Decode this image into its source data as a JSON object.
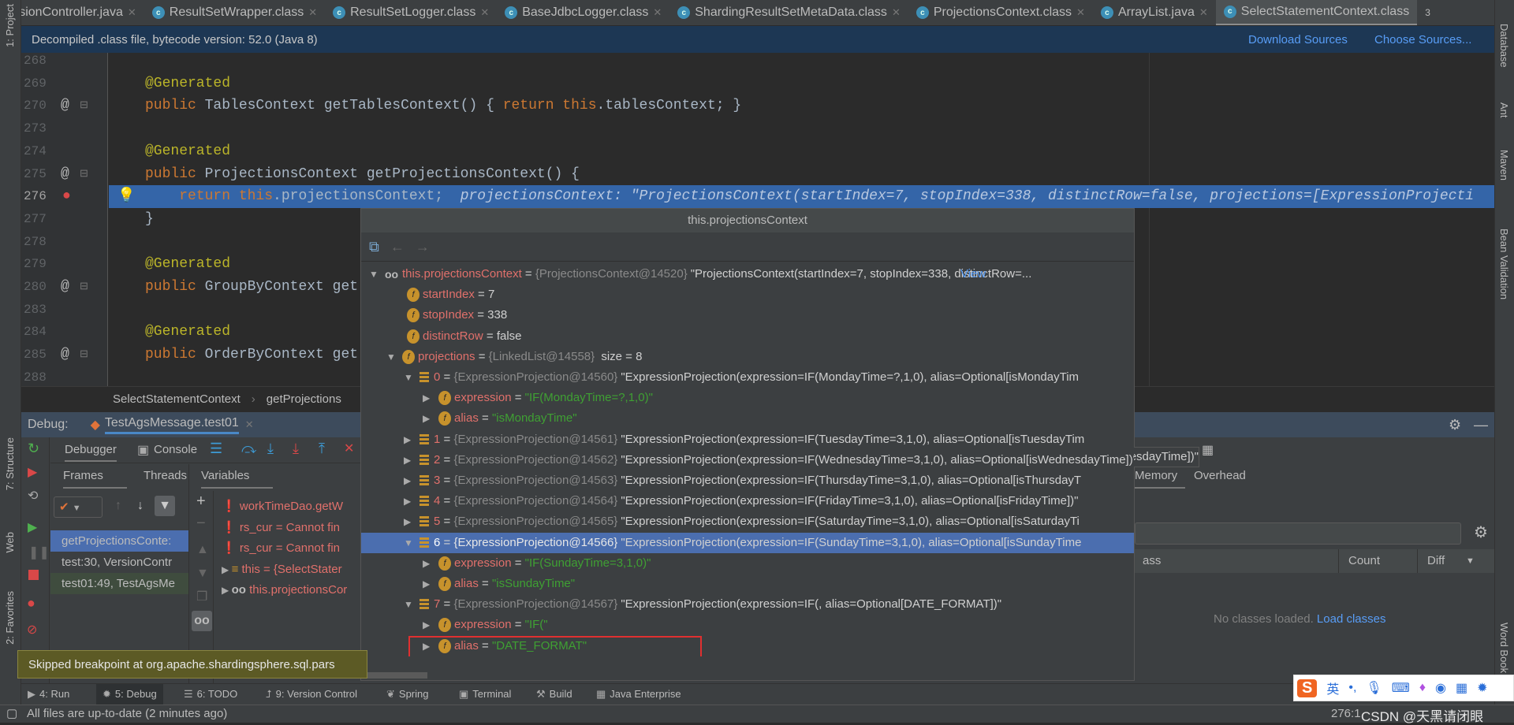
{
  "tabs": [
    {
      "label": "ersionController.java",
      "icon": "java-class-icon"
    },
    {
      "label": "ResultSetWrapper.class",
      "icon": "class-icon"
    },
    {
      "label": "ResultSetLogger.class",
      "icon": "class-icon"
    },
    {
      "label": "BaseJdbcLogger.class",
      "icon": "class-icon"
    },
    {
      "label": "ShardingResultSetMetaData.class",
      "icon": "class-icon"
    },
    {
      "label": "ProjectionsContext.class",
      "icon": "class-icon"
    },
    {
      "label": "ArrayList.java",
      "icon": "class-icon"
    },
    {
      "label": "SelectStatementContext.class",
      "icon": "class-icon",
      "active": true
    }
  ],
  "tab_overflow": "3",
  "left_tools": [
    "1: Project",
    "7: Structure",
    "Web",
    "2: Favorites"
  ],
  "right_tools": [
    "Database",
    "Ant",
    "Maven",
    "Bean Validation",
    "Word Book"
  ],
  "banner": {
    "text": "Decompiled .class file, bytecode version: 52.0 (Java 8)",
    "download": "Download Sources",
    "choose": "Choose Sources..."
  },
  "code_lines": [
    {
      "n": "268",
      "t": []
    },
    {
      "n": "269",
      "t": [
        [
          "an",
          "@Generated"
        ]
      ]
    },
    {
      "n": "270",
      "t": [
        [
          "kw",
          "public "
        ],
        [
          "",
          "TablesContext getTablesContext() { "
        ],
        [
          "kw",
          "return this"
        ],
        [
          "",
          ".tablesContext; }"
        ]
      ]
    },
    {
      "n": "273",
      "t": []
    },
    {
      "n": "274",
      "t": [
        [
          "an",
          "@Generated"
        ]
      ]
    },
    {
      "n": "275",
      "t": [
        [
          "kw",
          "public "
        ],
        [
          "",
          "ProjectionsContext getProjectionsContext() {"
        ]
      ]
    },
    {
      "n": "276",
      "current": true,
      "t": [
        [
          "kw",
          "    return "
        ],
        [
          "kw",
          "this"
        ],
        [
          "",
          ".projectionsContext; "
        ],
        [
          "hint",
          " projectionsContext: \"ProjectionsContext(startIndex=7, stopIndex=338, distinctRow=false, projections=[ExpressionProjecti"
        ]
      ]
    },
    {
      "n": "277",
      "t": [
        [
          "",
          "}"
        ]
      ]
    },
    {
      "n": "278",
      "t": []
    },
    {
      "n": "279",
      "t": [
        [
          "an",
          "@Generated"
        ]
      ]
    },
    {
      "n": "280",
      "t": [
        [
          "kw",
          "public "
        ],
        [
          "",
          "GroupByContext get"
        ]
      ]
    },
    {
      "n": "283",
      "t": []
    },
    {
      "n": "284",
      "t": [
        [
          "an",
          "@Generated"
        ]
      ]
    },
    {
      "n": "285",
      "t": [
        [
          "kw",
          "public "
        ],
        [
          "",
          "OrderByContext get"
        ]
      ]
    },
    {
      "n": "288",
      "t": []
    }
  ],
  "breadcrumb": [
    "SelectStatementContext",
    "getProjections"
  ],
  "debug": {
    "label": "Debug:",
    "session": "TestAgsMessage.test01",
    "tabs": [
      "Debugger",
      "Console"
    ],
    "frames_tabs": [
      "Frames",
      "Threads"
    ],
    "variables_tab": "Variables",
    "frames": [
      "getProjectionsConte:",
      "test:30, VersionContr",
      "test01:49, TestAgsMe"
    ],
    "variables": [
      {
        "kind": "error",
        "text": "workTimeDao.getW"
      },
      {
        "kind": "error",
        "text": "rs_cur = Cannot fin"
      },
      {
        "kind": "error",
        "text": "rs_cur = Cannot fin"
      },
      {
        "kind": "object",
        "text": "this = {SelectStater"
      },
      {
        "kind": "watch",
        "text": "this.projectionsCor"
      }
    ]
  },
  "popup": {
    "title": "this.projectionsContext",
    "rows": [
      {
        "lvl": 0,
        "arrow": "down",
        "icon": "watch",
        "name": "this.projectionsContext",
        "type": "{ProjectionsContext@14520}",
        "value": "\"ProjectionsContext(startIndex=7, stopIndex=338, distinctRow=...",
        "link": "View"
      },
      {
        "lvl": 1,
        "arrow": "none",
        "icon": "field",
        "name": "startIndex",
        "value": "7"
      },
      {
        "lvl": 1,
        "arrow": "none",
        "icon": "field",
        "name": "stopIndex",
        "value": "338"
      },
      {
        "lvl": 1,
        "arrow": "none",
        "icon": "field",
        "name": "distinctRow",
        "value": "false"
      },
      {
        "lvl": 1,
        "arrow": "down",
        "icon": "field",
        "name": "projections",
        "type": "{LinkedList@14558}",
        "value": " size = 8"
      },
      {
        "lvl": 2,
        "arrow": "down",
        "icon": "list",
        "name": "0",
        "type": "{ExpressionProjection@14560}",
        "value": "\"ExpressionProjection(expression=IF(MondayTime=?,1,0), alias=Optional[isMondayTim"
      },
      {
        "lvl": 3,
        "arrow": "right",
        "icon": "field",
        "name": "expression",
        "string": "\"IF(MondayTime=?,1,0)\""
      },
      {
        "lvl": 3,
        "arrow": "right",
        "icon": "field",
        "name": "alias",
        "string": "\"isMondayTime\""
      },
      {
        "lvl": 2,
        "arrow": "right",
        "icon": "list",
        "name": "1",
        "type": "{ExpressionProjection@14561}",
        "value": "\"ExpressionProjection(expression=IF(TuesdayTime=3,1,0), alias=Optional[isTuesdayTim"
      },
      {
        "lvl": 2,
        "arrow": "right",
        "icon": "list",
        "name": "2",
        "type": "{ExpressionProjection@14562}",
        "value": "\"ExpressionProjection(expression=IF(WednesdayTime=3,1,0), alias=Optional[isWednesdayTime])\"",
        "overflow": true
      },
      {
        "lvl": 2,
        "arrow": "right",
        "icon": "list",
        "name": "3",
        "type": "{ExpressionProjection@14563}",
        "value": "\"ExpressionProjection(expression=IF(ThursdayTime=3,1,0), alias=Optional[isThursdayT"
      },
      {
        "lvl": 2,
        "arrow": "right",
        "icon": "list",
        "name": "4",
        "type": "{ExpressionProjection@14564}",
        "value": "\"ExpressionProjection(expression=IF(FridayTime=3,1,0), alias=Optional[isFridayTime])\""
      },
      {
        "lvl": 2,
        "arrow": "right",
        "icon": "list",
        "name": "5",
        "type": "{ExpressionProjection@14565}",
        "value": "\"ExpressionProjection(expression=IF(SaturdayTime=3,1,0), alias=Optional[isSaturdayTi"
      },
      {
        "lvl": 2,
        "arrow": "down",
        "icon": "list",
        "name": "6",
        "type": "{ExpressionProjection@14566}",
        "value": "\"ExpressionProjection(expression=IF(SundayTime=3,1,0), alias=Optional[isSundayTime",
        "selected": true
      },
      {
        "lvl": 3,
        "arrow": "right",
        "icon": "field",
        "name": "expression",
        "string": "\"IF(SundayTime=3,1,0)\""
      },
      {
        "lvl": 3,
        "arrow": "right",
        "icon": "field",
        "name": "alias",
        "string": "\"isSundayTime\""
      },
      {
        "lvl": 2,
        "arrow": "down",
        "icon": "list",
        "name": "7",
        "type": "{ExpressionProjection@14567}",
        "value": "\"ExpressionProjection(expression=IF(, alias=Optional[DATE_FORMAT])\""
      },
      {
        "lvl": 3,
        "arrow": "right",
        "icon": "field",
        "name": "expression",
        "string": "\"IF(\""
      },
      {
        "lvl": 3,
        "arrow": "right",
        "icon": "field",
        "name": "alias",
        "string": "\"DATE_FORMAT\"",
        "highlighted": true
      }
    ]
  },
  "memory": {
    "tabs": [
      "Memory",
      "Overhead"
    ],
    "columns": [
      "ass",
      "Count",
      "Diff"
    ],
    "empty": "No classes loaded.",
    "load": "Load classes"
  },
  "tooltip": "Skipped breakpoint at org.apache.shardingsphere.sql.pars",
  "bottom_tools": [
    "4: Run",
    "5: Debug",
    "6: TODO",
    "9: Version Control",
    "Spring",
    "Terminal",
    "Build",
    "Java Enterprise"
  ],
  "status": {
    "text": "All files are up-to-date (2 minutes ago)",
    "position": "276:1",
    "watermark": "CSDN @天黑请闭眼"
  },
  "ime": {
    "lang": "英",
    "punct": "•,"
  },
  "colors": {
    "current_line": "#3465a8",
    "selection": "#4b6eaf",
    "highlight_box": "#e03030",
    "banner": "#1d3754"
  }
}
